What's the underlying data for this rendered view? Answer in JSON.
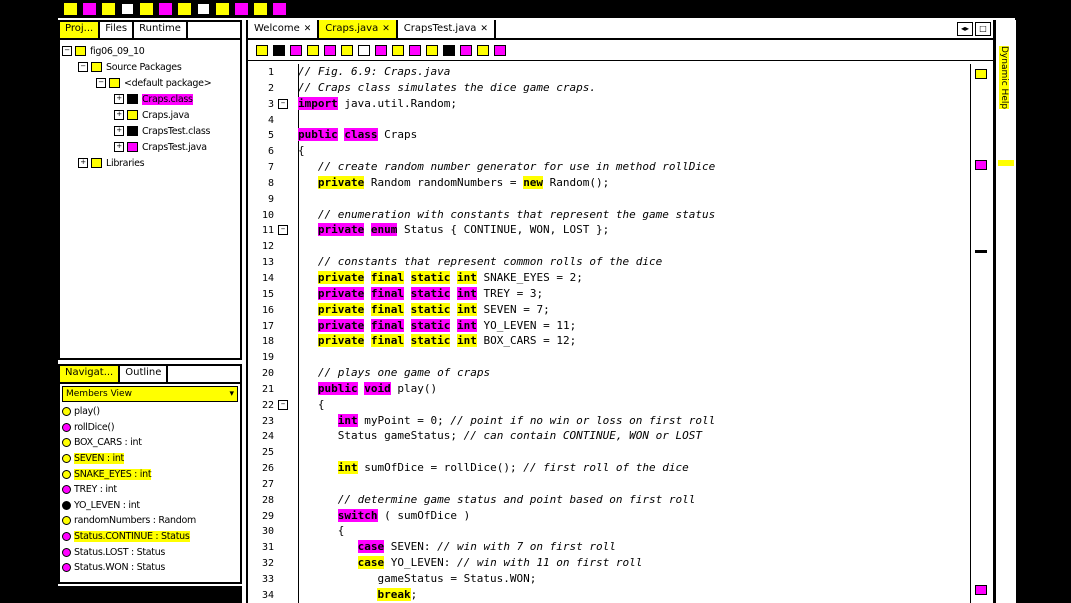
{
  "projects_panel": {
    "tabs": [
      "Proj...",
      "Files",
      "Runtime"
    ],
    "tree": [
      {
        "label": "fig06_09_10",
        "indent": 0
      },
      {
        "label": "Source Packages",
        "indent": 1
      },
      {
        "label": "<default package>",
        "indent": 2
      },
      {
        "label": "Craps.class",
        "indent": 3
      },
      {
        "label": "Craps.java",
        "indent": 3
      },
      {
        "label": "CrapsTest.class",
        "indent": 3
      },
      {
        "label": "CrapsTest.java",
        "indent": 3
      },
      {
        "label": "Libraries",
        "indent": 1
      }
    ]
  },
  "navigator_panel": {
    "tabs": [
      "Navigat...",
      "Outline"
    ],
    "view_label": "Members View",
    "members": [
      {
        "label": "play()",
        "kind": "method"
      },
      {
        "label": "rollDice()",
        "kind": "method"
      },
      {
        "label": "BOX_CARS : int",
        "kind": "field"
      },
      {
        "label": "SEVEN : int",
        "kind": "field"
      },
      {
        "label": "SNAKE_EYES : int",
        "kind": "field"
      },
      {
        "label": "TREY : int",
        "kind": "field"
      },
      {
        "label": "YO_LEVEN : int",
        "kind": "field"
      },
      {
        "label": "randomNumbers : Random",
        "kind": "field"
      },
      {
        "label": "Status.CONTINUE : Status",
        "kind": "enum"
      },
      {
        "label": "Status.LOST : Status",
        "kind": "enum"
      },
      {
        "label": "Status.WON : Status",
        "kind": "enum"
      }
    ]
  },
  "editor": {
    "tabs": [
      "Welcome",
      "Craps.java",
      "CrapsTest.java"
    ],
    "active_tab": 1,
    "right_label": "Dynamic Help",
    "lines": [
      {
        "n": "1",
        "text": "// Fig. 6.9: Craps.java"
      },
      {
        "n": "2",
        "text": "// Craps class simulates the dice game craps."
      },
      {
        "n": "3",
        "text": "import java.util.Random;"
      },
      {
        "n": "4",
        "text": ""
      },
      {
        "n": "5",
        "text": "public class Craps"
      },
      {
        "n": "6",
        "text": "{"
      },
      {
        "n": "7",
        "text": "   // create random number generator for use in method rollDice"
      },
      {
        "n": "8",
        "text": "   private Random randomNumbers = new Random();"
      },
      {
        "n": "9",
        "text": ""
      },
      {
        "n": "10",
        "text": "   // enumeration with constants that represent the game status"
      },
      {
        "n": "11",
        "text": "   private enum Status { CONTINUE, WON, LOST };"
      },
      {
        "n": "12",
        "text": ""
      },
      {
        "n": "13",
        "text": "   // constants that represent common rolls of the dice"
      },
      {
        "n": "14",
        "text": "   private final static int SNAKE_EYES = 2;"
      },
      {
        "n": "15",
        "text": "   private final static int TREY = 3;"
      },
      {
        "n": "16",
        "text": "   private final static int SEVEN = 7;"
      },
      {
        "n": "17",
        "text": "   private final static int YO_LEVEN = 11;"
      },
      {
        "n": "18",
        "text": "   private final static int BOX_CARS = 12;"
      },
      {
        "n": "19",
        "text": ""
      },
      {
        "n": "20",
        "text": "   // plays one game of craps"
      },
      {
        "n": "21",
        "text": "   public void play()"
      },
      {
        "n": "22",
        "text": "   {"
      },
      {
        "n": "23",
        "text": "      int myPoint = 0; // point if no win or loss on first roll"
      },
      {
        "n": "24",
        "text": "      Status gameStatus; // can contain CONTINUE, WON or LOST"
      },
      {
        "n": "25",
        "text": ""
      },
      {
        "n": "26",
        "text": "      int sumOfDice = rollDice(); // first roll of the dice"
      },
      {
        "n": "27",
        "text": ""
      },
      {
        "n": "28",
        "text": "      // determine game status and point based on first roll"
      },
      {
        "n": "29",
        "text": "      switch ( sumOfDice )"
      },
      {
        "n": "30",
        "text": "      {"
      },
      {
        "n": "31",
        "text": "         case SEVEN: // win with 7 on first roll"
      },
      {
        "n": "32",
        "text": "         case YO_LEVEN: // win with 11 on first roll"
      },
      {
        "n": "33",
        "text": "            gameStatus = Status.WON;"
      },
      {
        "n": "34",
        "text": "            break;"
      }
    ]
  },
  "colors": {
    "highlight_yellow": "#ffff00",
    "highlight_magenta": "#ff00ff"
  }
}
